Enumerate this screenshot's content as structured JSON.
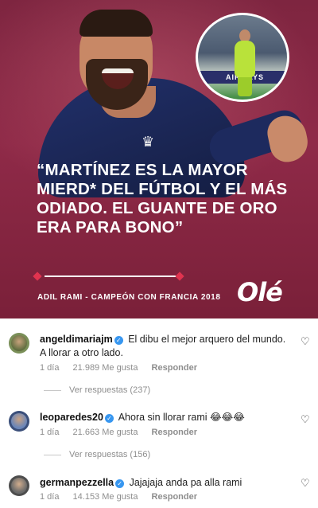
{
  "post": {
    "quote": "“MARTÍNEZ ES LA MAYOR MIERD* DEL FÚTBOL Y EL MÁS ODIADO. EL GUANTE DE ORO ERA PARA BONO”",
    "credit": "ADIL RAMI - CAMPEÓN CON FRANCIA 2018",
    "logo": "Olé",
    "inset_banner": "AIRWAYS",
    "colors": {
      "background": "#8a2744",
      "accent": "#e0334f"
    }
  },
  "comments": [
    {
      "username": "angeldimariajm",
      "verified": true,
      "text": "El dibu el mejor arquero del mundo. A llorar a otro lado.",
      "age": "1 día",
      "likes": "21.989 Me gusta",
      "reply_label": "Responder",
      "view_replies": "Ver respuestas (237)",
      "like_icon": "heart-outline-icon"
    },
    {
      "username": "leoparedes20",
      "verified": true,
      "text": "Ahora sin llorar rami 😂😂😂",
      "age": "1 día",
      "likes": "21.663 Me gusta",
      "reply_label": "Responder",
      "view_replies": "Ver respuestas (156)",
      "like_icon": "heart-outline-icon"
    },
    {
      "username": "germanpezzella",
      "verified": true,
      "text": "Jajajaja anda pa alla rami",
      "age": "1 día",
      "likes": "14.153 Me gusta",
      "reply_label": "Responder",
      "like_icon": "heart-outline-icon"
    }
  ]
}
